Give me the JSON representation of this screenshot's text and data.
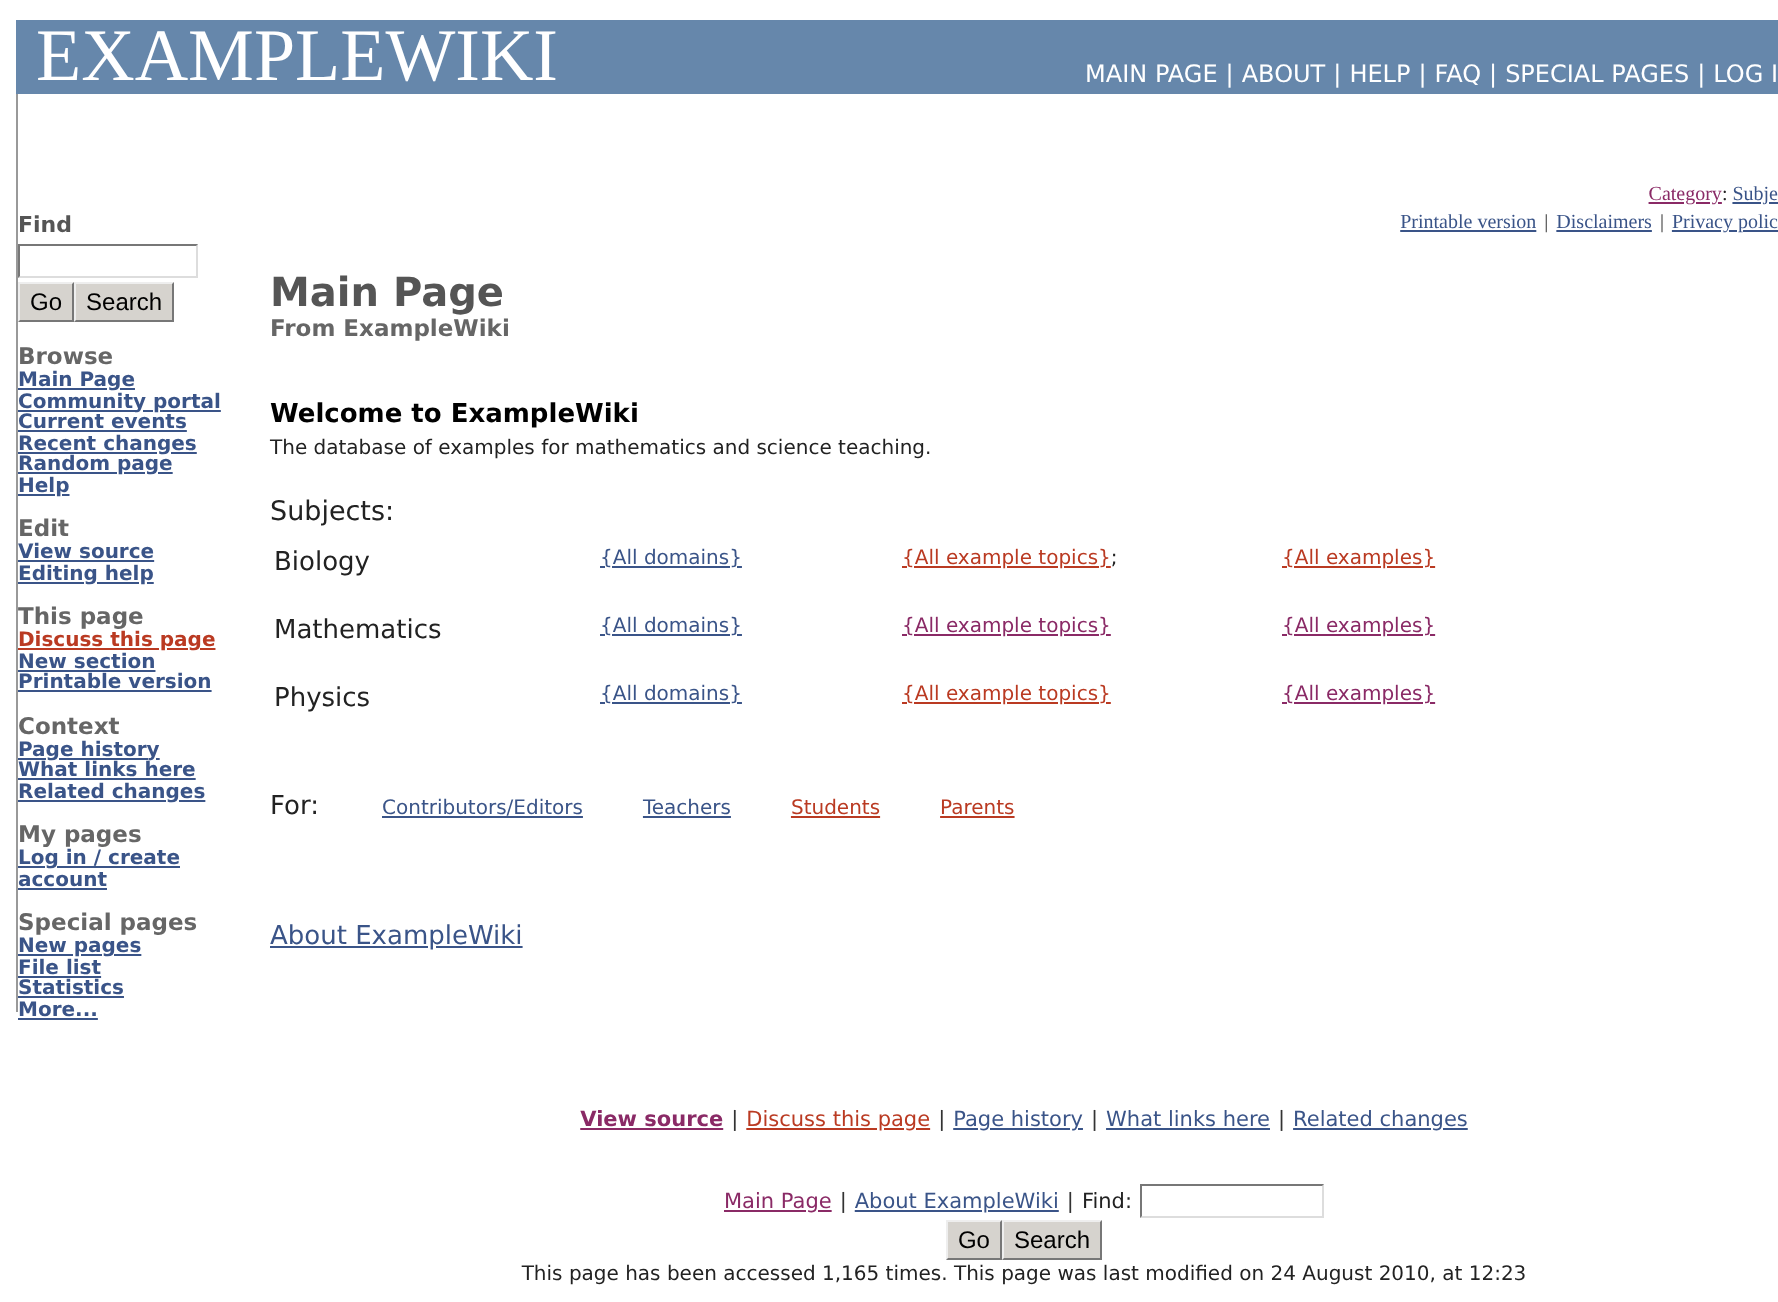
{
  "header": {
    "logo": "EXAMPLEWIKI",
    "separator": "|",
    "nav": [
      "MAIN PAGE",
      "ABOUT",
      "HELP",
      "FAQ",
      "SPECIAL PAGES",
      "LOG I"
    ]
  },
  "category_line": [
    {
      "text": "Category",
      "kind": "visited"
    },
    {
      "text": ":",
      "kind": "punct"
    },
    {
      "text": "Subje",
      "kind": "link"
    }
  ],
  "tools_line": [
    {
      "text": "Printable version",
      "kind": "link"
    },
    {
      "text": "|",
      "kind": "sep"
    },
    {
      "text": "Disclaimers",
      "kind": "link"
    },
    {
      "text": "|",
      "kind": "sep"
    },
    {
      "text": "Privacy polic",
      "kind": "link"
    }
  ],
  "sidebar": {
    "find": {
      "label": "Find",
      "buttons": [
        "Go",
        "Search"
      ]
    },
    "groups": [
      {
        "title": "Browse",
        "links": [
          {
            "text": "Main Page",
            "kind": "link"
          },
          {
            "text": "Community portal",
            "kind": "link"
          },
          {
            "text": "Current events",
            "kind": "link"
          },
          {
            "text": "Recent changes",
            "kind": "link"
          },
          {
            "text": "Random page",
            "kind": "link"
          },
          {
            "text": "Help",
            "kind": "link"
          }
        ]
      },
      {
        "title": "Edit",
        "links": [
          {
            "text": "View source",
            "kind": "link"
          },
          {
            "text": "Editing help",
            "kind": "link"
          }
        ]
      },
      {
        "title": "This page",
        "links": [
          {
            "text": "Discuss this page",
            "kind": "new"
          },
          {
            "text": "New section",
            "kind": "link"
          },
          {
            "text": "Printable version",
            "kind": "link"
          }
        ]
      },
      {
        "title": "Context",
        "links": [
          {
            "text": "Page history",
            "kind": "link"
          },
          {
            "text": "What links here",
            "kind": "link"
          },
          {
            "text": "Related changes",
            "kind": "link"
          }
        ]
      },
      {
        "title": "My pages",
        "links": [
          {
            "text": "Log in / create account",
            "kind": "link"
          }
        ]
      },
      {
        "title": "Special pages",
        "links": [
          {
            "text": "New pages",
            "kind": "link"
          },
          {
            "text": "File list",
            "kind": "link"
          },
          {
            "text": "Statistics",
            "kind": "link"
          },
          {
            "text": "More...",
            "kind": "link"
          }
        ]
      }
    ]
  },
  "main": {
    "title": "Main Page",
    "subtitle": "From ExampleWiki",
    "welcome": "Welcome to ExampleWiki",
    "description": "The database of examples for mathematics and science teaching.",
    "subjects_label": "Subjects:",
    "subjects": [
      {
        "name": "Biology",
        "cells": [
          [
            {
              "text": "{All domains}",
              "kind": "link"
            }
          ],
          [
            {
              "text": "{All example topics}",
              "kind": "new"
            },
            {
              "text": ";",
              "kind": "punct"
            }
          ],
          [
            {
              "text": "{All examples}",
              "kind": "new"
            }
          ]
        ]
      },
      {
        "name": "Mathematics",
        "cells": [
          [
            {
              "text": "{All domains}",
              "kind": "link"
            }
          ],
          [
            {
              "text": "{All example topics}",
              "kind": "visited"
            }
          ],
          [
            {
              "text": "{All examples}",
              "kind": "visited"
            }
          ]
        ]
      },
      {
        "name": "Physics",
        "cells": [
          [
            {
              "text": "{All domains}",
              "kind": "link"
            }
          ],
          [
            {
              "text": "{All example topics}",
              "kind": "new"
            }
          ],
          [
            {
              "text": "{All examples}",
              "kind": "visited"
            }
          ]
        ]
      }
    ],
    "for_label": "For:",
    "audiences": [
      {
        "text": "Contributors/Editors",
        "kind": "link"
      },
      {
        "text": "Teachers",
        "kind": "link"
      },
      {
        "text": "Students",
        "kind": "new"
      },
      {
        "text": "Parents",
        "kind": "new"
      }
    ],
    "about": {
      "text": "About ExampleWiki",
      "kind": "link"
    }
  },
  "footer": {
    "actions": [
      {
        "text": "View source",
        "kind": "current"
      },
      {
        "text": "|",
        "kind": "sep"
      },
      {
        "text": "Discuss this page",
        "kind": "new"
      },
      {
        "text": "|",
        "kind": "sep"
      },
      {
        "text": "Page history",
        "kind": "link"
      },
      {
        "text": "|",
        "kind": "sep"
      },
      {
        "text": "What links here",
        "kind": "link"
      },
      {
        "text": "|",
        "kind": "sep"
      },
      {
        "text": "Related changes",
        "kind": "link"
      }
    ],
    "nav": [
      {
        "text": "Main Page",
        "kind": "visited"
      },
      {
        "text": "|",
        "kind": "sep"
      },
      {
        "text": "About ExampleWiki",
        "kind": "link"
      },
      {
        "text": "|",
        "kind": "sep"
      },
      {
        "text": "Find:",
        "kind": "plain"
      }
    ],
    "buttons": [
      "Go",
      "Search"
    ],
    "accessed": "This page has been accessed 1,165 times. This page was last modified on 24 August 2010, at 12:23"
  }
}
